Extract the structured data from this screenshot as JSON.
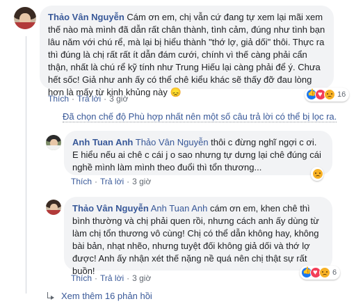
{
  "comment1": {
    "author": "Thảo Vân Nguyễn",
    "text": "Cám ơn em, chị vẫn cứ đang tự xem lại mãi xem thế nào mà mình đã dẫn rất chân thành, tình cảm, đúng như tình bạn lâu năm với chú rể, mà lại bị hiểu thành \"thớ lợ, giả dối\" thôi. Thực ra thì đúng là chị rất rất ít dẫn đám cưới, chính vì thế càng phải cẩn thận, nhất là chú rể kỹ tính như Trung Hiếu lại càng phải để ý. Chưa hết sốc! Giả như anh ấy có thể chê kiểu khác sẽ thấy đỡ đau lòng hơn là mấy từ kinh khủng này",
    "emoji": "😞",
    "action_like": "Thích",
    "action_reply": "Trả lời",
    "time": "3 giờ",
    "reaction_count": "16"
  },
  "filter_notice": "Đã chọn chế độ Phù hợp nhất nên một số câu trả lời có thể bị lọc ra.",
  "reply1": {
    "author": "Anh Tuan Anh",
    "mention": "Thảo Vân Nguyễn",
    "text": " thôi c đừng nghĩ ngợi c ơi. E hiểu nếu ai chê c cái j o sao nhưng tự dưng lại chê đúng cái nghề mình làm mình theo đuổi thì tổn thương...",
    "action_like": "Thích",
    "action_reply": "Trả lời",
    "time": "3 giờ"
  },
  "reply2": {
    "author": "Thảo Vân Nguyễn",
    "mention": "Anh Tuan Anh",
    "text": " cám ơn em, khen chê thì bình thường và chị phải quen rồi, nhưng cách anh ấy dùng từ làm chị tổn thương vô cùng! Chị có thể dẫn không hay, không bài bản, nhạt nhẽo, nhưng tuyệt đối không giả dối và thớ lợ được! Anh ấy nhận xét thế nặng nề quá nên chị thật sự rất buồn!",
    "action_like": "Thích",
    "action_reply": "Trả lời",
    "time": "3 giờ",
    "reaction_count": "6"
  },
  "see_more": "Xem thêm 16 phản hồi",
  "colors": {
    "link": "#385898",
    "bubble": "#f2f3f5",
    "meta": "#606770"
  }
}
